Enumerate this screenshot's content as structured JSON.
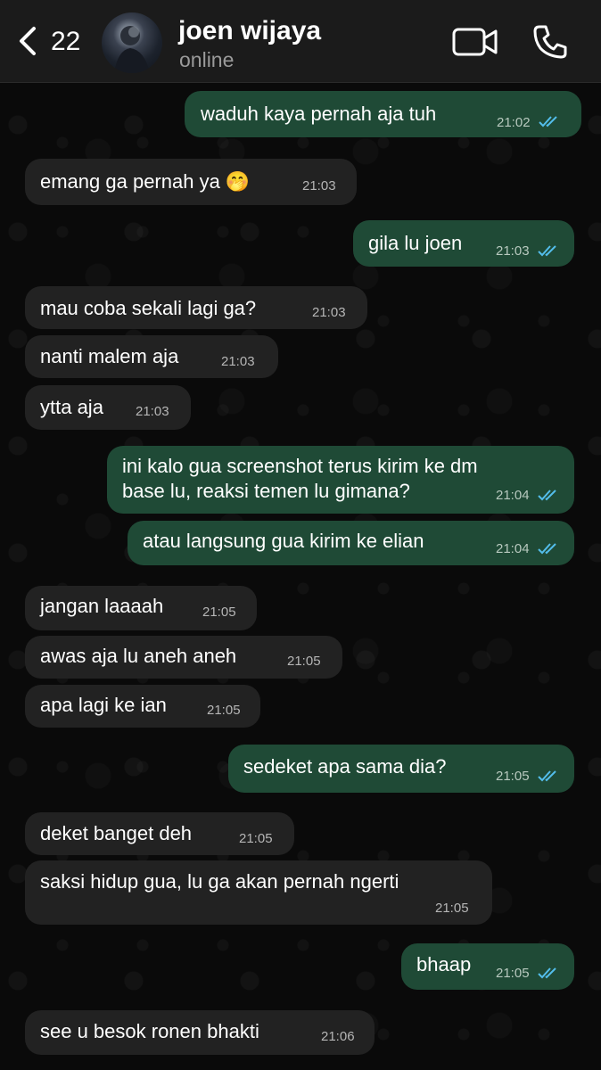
{
  "header": {
    "back_count": "22",
    "contact_name": "joen wijaya",
    "status": "online"
  },
  "messages": [
    {
      "dir": "out",
      "text": "waduh kaya pernah aja tuh",
      "time": "21:02",
      "read": true
    },
    {
      "dir": "in",
      "text": "emang ga pernah ya 🤭",
      "time": "21:03"
    },
    {
      "dir": "out",
      "text": "gila lu joen",
      "time": "21:03",
      "read": true
    },
    {
      "dir": "in",
      "text": "mau coba sekali lagi ga?",
      "time": "21:03"
    },
    {
      "dir": "in",
      "text": "nanti malem aja",
      "time": "21:03"
    },
    {
      "dir": "in",
      "text": "ytta aja",
      "time": "21:03"
    },
    {
      "dir": "out",
      "text_line1": "ini kalo gua screenshot terus kirim ke dm",
      "text_line2": "base lu, reaksi temen lu gimana?",
      "time": "21:04",
      "read": true
    },
    {
      "dir": "out",
      "text": "atau langsung gua kirim ke elian",
      "time": "21:04",
      "read": true
    },
    {
      "dir": "in",
      "text": "jangan laaaah",
      "time": "21:05"
    },
    {
      "dir": "in",
      "text": "awas aja lu aneh aneh",
      "time": "21:05"
    },
    {
      "dir": "in",
      "text": "apa lagi ke ian",
      "time": "21:05"
    },
    {
      "dir": "out",
      "text": "sedeket apa sama dia?",
      "time": "21:05",
      "read": true
    },
    {
      "dir": "in",
      "text": "deket banget deh",
      "time": "21:05"
    },
    {
      "dir": "in",
      "text": "saksi hidup gua, lu ga akan pernah ngerti",
      "time": "21:05"
    },
    {
      "dir": "out",
      "text": "bhaap",
      "time": "21:05",
      "read": true
    },
    {
      "dir": "in",
      "text": "see u besok ronen bhakti",
      "time": "21:06"
    }
  ],
  "colors": {
    "incoming_bubble": "#222222",
    "outgoing_bubble": "#1f4a36",
    "read_tick": "#53bdeb",
    "header_bg": "#1b1b1b"
  },
  "icons": [
    "chevron-left-icon",
    "video-camera-icon",
    "phone-icon",
    "double-check-icon"
  ]
}
